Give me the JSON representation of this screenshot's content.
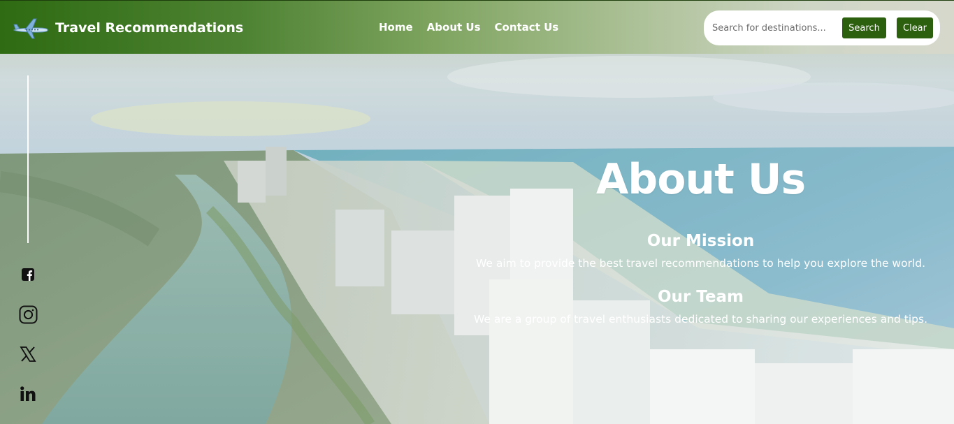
{
  "header": {
    "brand_title": "Travel Recommendations",
    "logo_icon": "airplane-icon"
  },
  "nav": {
    "items": [
      {
        "label": "Home"
      },
      {
        "label": "About Us"
      },
      {
        "label": "Contact Us"
      }
    ]
  },
  "search": {
    "placeholder": "Search for destinations...",
    "value": "",
    "search_label": "Search",
    "clear_label": "Clear"
  },
  "social": {
    "items": [
      {
        "icon": "facebook-icon"
      },
      {
        "icon": "instagram-icon"
      },
      {
        "icon": "x-twitter-icon"
      },
      {
        "icon": "linkedin-icon"
      }
    ]
  },
  "about": {
    "title": "About Us",
    "sections": [
      {
        "title": "Our Mission",
        "text": "We aim to provide the best travel recommendations to help you explore the world."
      },
      {
        "title": "Our Team",
        "text": "We are a group of travel enthusiasts dedicated to sharing our experiences and tips."
      }
    ]
  },
  "colors": {
    "nav_gradient_start": "#2e6b12",
    "nav_gradient_end": "#d6d8cc",
    "button_bg": "#2c5f0e",
    "text_white": "#ffffff"
  }
}
